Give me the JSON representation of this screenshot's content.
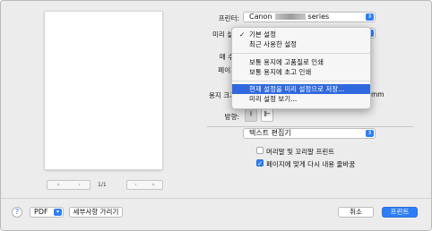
{
  "printer": {
    "label": "프린터:",
    "value_prefix": "Canon",
    "value_suffix": "series"
  },
  "presets": {
    "label": "미리 설정"
  },
  "copies": {
    "label": "매 수"
  },
  "pages": {
    "label": "페이지"
  },
  "paper_size": {
    "label": "용지 크기",
    "unit": "mm"
  },
  "orientation": {
    "label": "방향:",
    "portrait_icon": "portrait-person-icon",
    "landscape_icon": "landscape-person-icon"
  },
  "preset_menu": {
    "items": [
      {
        "label": "기본 설정",
        "checked": true
      },
      {
        "label": "최근 사용한 설정"
      },
      {
        "label": "보통 용지에 고품질로 인쇄"
      },
      {
        "label": "보통 용지에 초고 인쇄"
      },
      {
        "label": "현재 설정을 미리 설정으로 저장...",
        "highlighted": true
      },
      {
        "label": "미리 설정 보기..."
      }
    ],
    "check_glyph": "✓"
  },
  "app_section": {
    "value": "텍스트 편집기"
  },
  "options": [
    {
      "label": "머리말 및 꼬리말 프린트",
      "checked": false
    },
    {
      "label": "페이지에 맞게 다시 내용 줄바꿈",
      "checked": true
    }
  ],
  "preview": {
    "page_indicator": "1/1",
    "first_glyph": "«",
    "prev_glyph": "‹",
    "next_glyph": "›",
    "last_glyph": "»"
  },
  "footer": {
    "help_glyph": "?",
    "pdf_label": "PDF",
    "hide_details_label": "세부사항 가리기",
    "cancel_label": "취소",
    "print_label": "프린트"
  },
  "colors": {
    "accent": "#2f7ef7",
    "highlight": "#2f69dd",
    "dialog_bg": "#ececec"
  }
}
